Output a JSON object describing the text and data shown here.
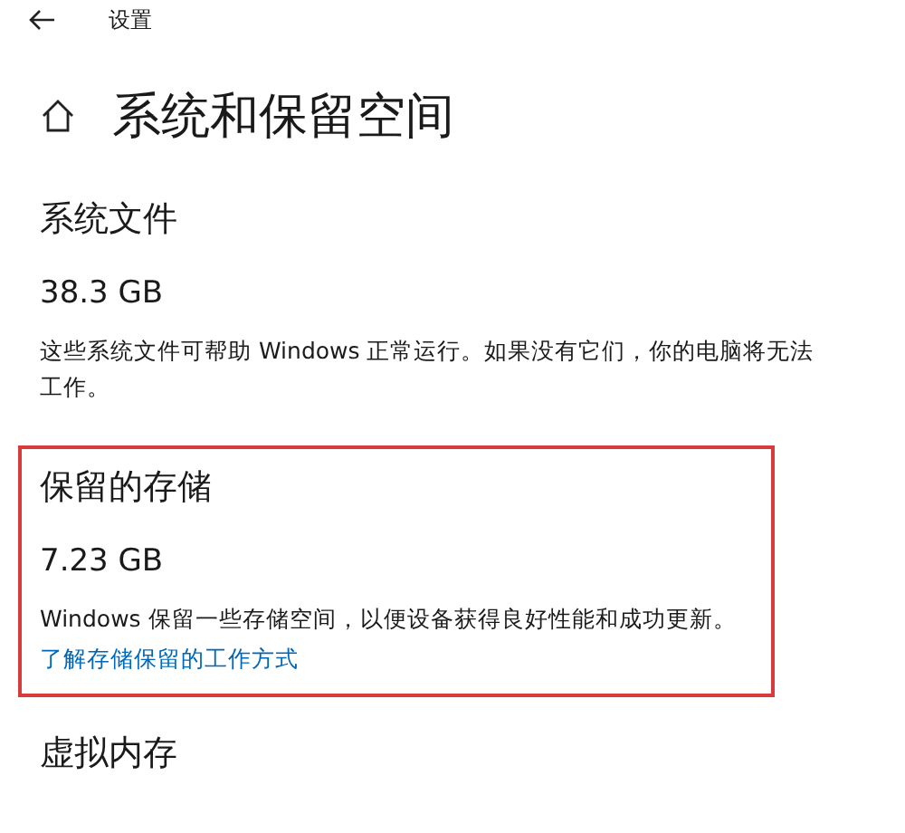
{
  "header": {
    "title": "设置"
  },
  "page": {
    "title": "系统和保留空间"
  },
  "sections": [
    {
      "heading": "系统文件",
      "size": "38.3 GB",
      "description": "这些系统文件可帮助 Windows 正常运行。如果没有它们，你的电脑将无法工作。",
      "highlighted": false
    },
    {
      "heading": "保留的存储",
      "size": "7.23 GB",
      "description": "Windows 保留一些存储空间，以便设备获得良好性能和成功更新。",
      "link": "了解存储保留的工作方式",
      "highlighted": true
    },
    {
      "heading": "虚拟内存",
      "highlighted": false
    }
  ]
}
